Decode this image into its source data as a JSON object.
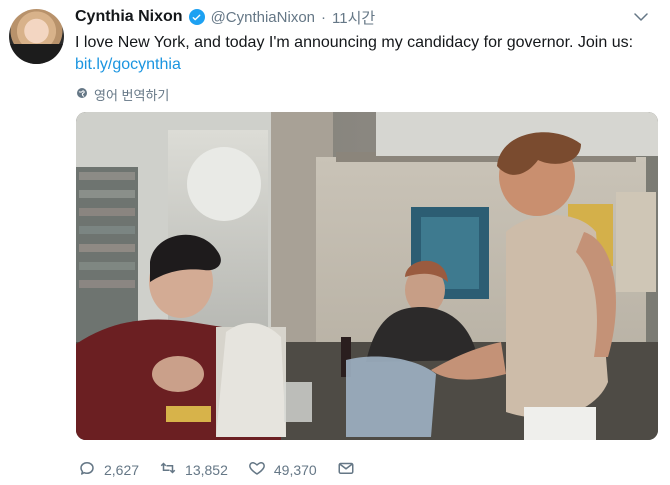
{
  "tweet": {
    "author_name": "Cynthia Nixon",
    "handle": "@CynthiaNixon",
    "dot": "·",
    "time": "11시간",
    "text": "I love New York, and today I'm announcing my candidacy for governor. Join us:",
    "link": "bit.ly/gocynthia",
    "translate_label": "영어 번역하기"
  },
  "stats": {
    "replies": "2,627",
    "retweets": "13,852",
    "likes": "49,370"
  },
  "icons": {
    "verified": "verified-badge-icon",
    "caret": "chevron-down-icon",
    "globe": "globe-icon",
    "reply": "reply-icon",
    "retweet": "retweet-icon",
    "like": "heart-icon",
    "dm": "envelope-icon"
  },
  "colors": {
    "link": "#1b95e0",
    "verified": "#1da1f2",
    "muted": "#657786",
    "text": "#14171a"
  }
}
